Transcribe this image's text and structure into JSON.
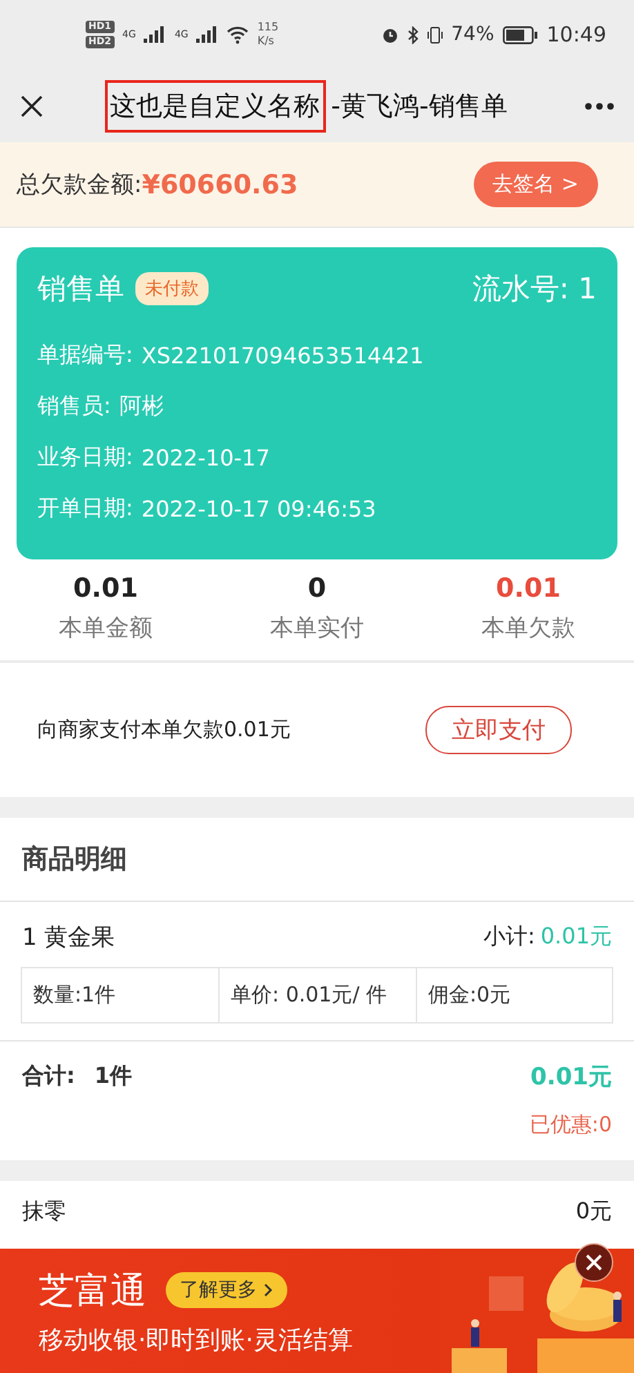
{
  "status_bar": {
    "sim_labels": [
      "HD1",
      "HD2"
    ],
    "networks": [
      "4G",
      "4G"
    ],
    "speed": "115",
    "speed_unit": "K/s",
    "battery": "74%",
    "time": "10:49"
  },
  "nav": {
    "title_parts": [
      {
        "text": "这也是自定义名称",
        "highlighted": true
      },
      {
        "text": "-黄飞鸿-销售单",
        "highlighted": false
      }
    ]
  },
  "debt_bar": {
    "label": "总欠款金额:",
    "amount": "¥60660.63",
    "button": "去签名 >"
  },
  "order_card": {
    "title": "销售单",
    "badge": "未付款",
    "serial": "流水号: 1",
    "fields": [
      {
        "label": "单据编号:",
        "value": "XS221017094653514421"
      },
      {
        "label": "销售员:",
        "value": "阿彬"
      },
      {
        "label": "业务日期:",
        "value": "2022-10-17"
      },
      {
        "label": "开单日期:",
        "value": "2022-10-17 09:46:53"
      }
    ]
  },
  "summary": [
    {
      "value": "0.01",
      "label": "本单金额",
      "highlight": false
    },
    {
      "value": "0",
      "label": "本单实付",
      "highlight": false
    },
    {
      "value": "0.01",
      "label": "本单欠款",
      "highlight": true
    }
  ],
  "payment": {
    "text": "向商家支付本单欠款0.01元",
    "button": "立即支付"
  },
  "goods": {
    "title": "商品明细",
    "items": [
      {
        "name": "1 黄金果",
        "subtotal_label": "小计:",
        "subtotal": "0.01元",
        "cells": [
          "数量:1件",
          "单价: 0.01元/ 件",
          "佣金:0元"
        ]
      }
    ]
  },
  "total": {
    "label": "合计:",
    "count": "1件",
    "amount": "0.01元",
    "discount": "已优惠:0"
  },
  "rounding": {
    "label": "抹零",
    "value": "0元"
  },
  "ad": {
    "brand": "芝富通",
    "button": "了解更多",
    "slogan": "移动收银·即时到账·灵活结算"
  }
}
